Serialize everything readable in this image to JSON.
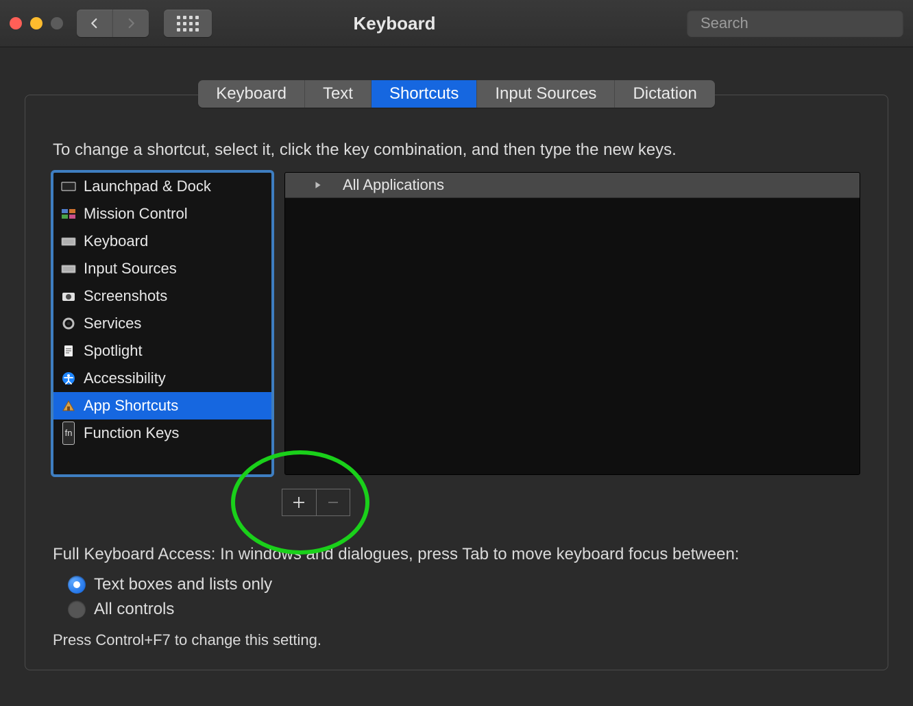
{
  "window": {
    "title": "Keyboard"
  },
  "search": {
    "placeholder": "Search"
  },
  "tabs": [
    {
      "label": "Keyboard",
      "active": false
    },
    {
      "label": "Text",
      "active": false
    },
    {
      "label": "Shortcuts",
      "active": true
    },
    {
      "label": "Input Sources",
      "active": false
    },
    {
      "label": "Dictation",
      "active": false
    }
  ],
  "hint": "To change a shortcut, select it, click the key combination, and then type the new keys.",
  "categories": [
    {
      "label": "Launchpad & Dock",
      "icon": "launchpad",
      "selected": false
    },
    {
      "label": "Mission Control",
      "icon": "mission-control",
      "selected": false
    },
    {
      "label": "Keyboard",
      "icon": "keyboard",
      "selected": false
    },
    {
      "label": "Input Sources",
      "icon": "keyboard",
      "selected": false
    },
    {
      "label": "Screenshots",
      "icon": "camera",
      "selected": false
    },
    {
      "label": "Services",
      "icon": "gear",
      "selected": false
    },
    {
      "label": "Spotlight",
      "icon": "document",
      "selected": false
    },
    {
      "label": "Accessibility",
      "icon": "accessibility",
      "selected": false
    },
    {
      "label": "App Shortcuts",
      "icon": "app-shortcuts",
      "selected": true
    },
    {
      "label": "Function Keys",
      "icon": "fn",
      "selected": false
    }
  ],
  "detail": {
    "header_label": "All Applications"
  },
  "add_label": "+",
  "remove_label": "−",
  "fka": {
    "lead": "Full Keyboard Access: In windows and dialogues, press Tab to move keyboard focus between:",
    "options": [
      {
        "label": "Text boxes and lists only",
        "selected": true
      },
      {
        "label": "All controls",
        "selected": false
      }
    ],
    "footnote": "Press Control+F7 to change this setting."
  },
  "colors": {
    "accent_blue": "#1667e0",
    "focus_ring": "#3e7ec1",
    "annotation_green": "#1ad01a"
  }
}
